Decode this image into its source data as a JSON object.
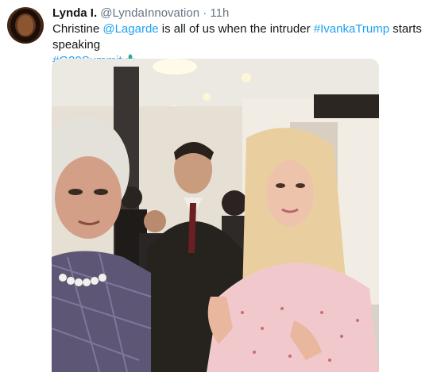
{
  "tweet": {
    "display_name": "Lynda I.",
    "handle": "@LyndaInnovation",
    "separator": "·",
    "timestamp": "11h",
    "text_parts": {
      "p1": "Christine ",
      "mention": "@Lagarde",
      "p2": " is all of us when the intruder ",
      "hashtag1": "#IvankaTrump",
      "p3": " starts speaking ",
      "hashtag2": "#G20Summit"
    },
    "emoji_icon": "g20-summit-emoji-icon",
    "media_icon": "video-still-image"
  },
  "colors": {
    "link": "#1da1f2",
    "text": "#14171a",
    "muted": "#657786"
  }
}
